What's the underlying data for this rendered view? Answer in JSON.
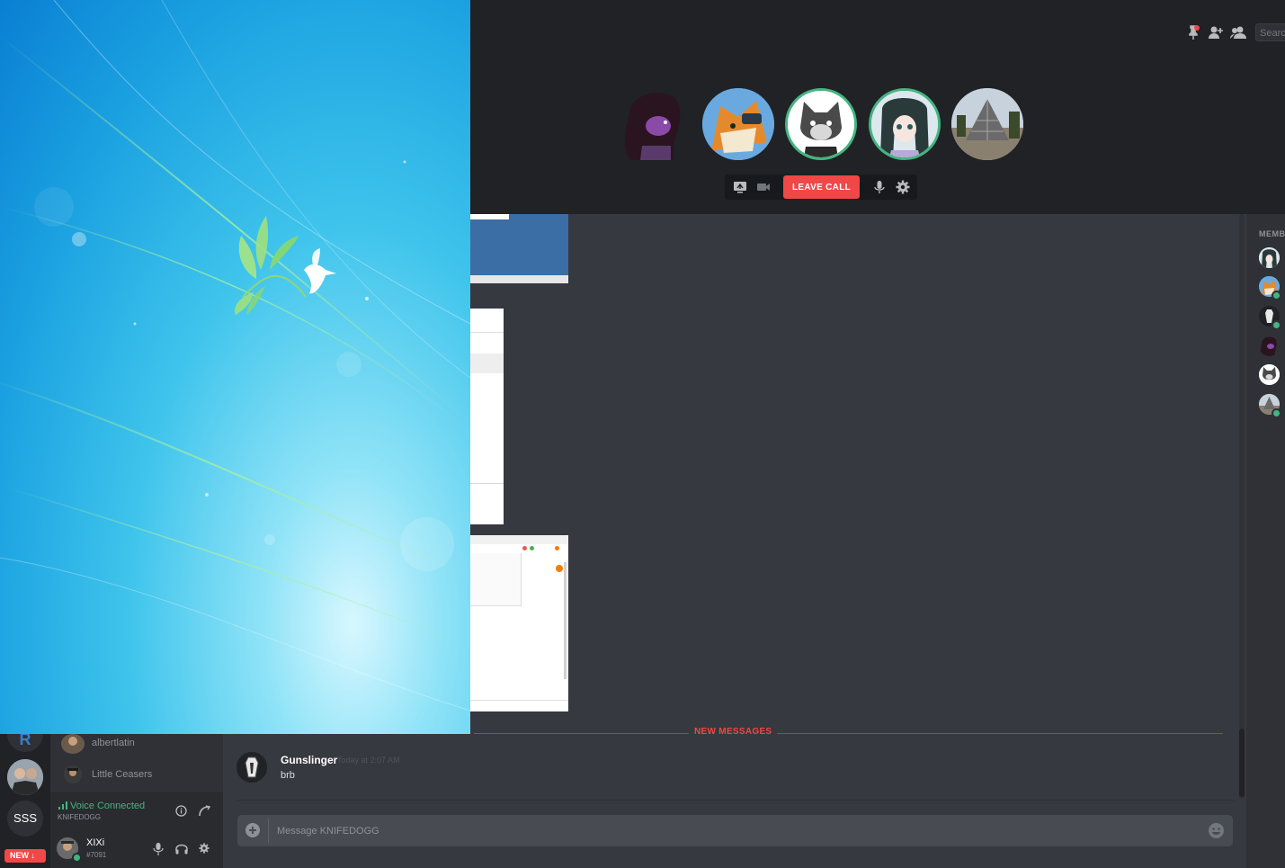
{
  "header": {
    "search_placeholder": "Search",
    "icons": [
      "pin-icon",
      "add-friend-icon",
      "members-icon"
    ]
  },
  "call": {
    "participants": [
      "Purple haired character",
      "Fox pilot",
      "Grey wolf",
      "Dark haired anime girl",
      "Glass pyramid"
    ],
    "leave_label": "LEAVE CALL",
    "controls": [
      "screen-share-icon",
      "video-icon",
      "mic-icon",
      "settings-icon"
    ]
  },
  "chat": {
    "new_messages_label": "NEW MESSAGES",
    "message": {
      "author": "Gunslinger",
      "time": "Today at 2:07 AM",
      "text": "brb"
    },
    "composer_placeholder": "Message KNIFEDOGG"
  },
  "members": {
    "header": "MEMBERS"
  },
  "sidebar": {
    "voice_users": [
      "albertlatin",
      "Little Ceasers"
    ],
    "guild_sss": "SSS",
    "new_badge": "NEW",
    "voice_status": "Voice Connected",
    "voice_channel": "KNIFEDOGG",
    "username": "XIXi",
    "discriminator": "#7091"
  },
  "colors": {
    "accent_red": "#f04747",
    "online_green": "#43b581",
    "background": "#36393f",
    "header": "#202225"
  }
}
